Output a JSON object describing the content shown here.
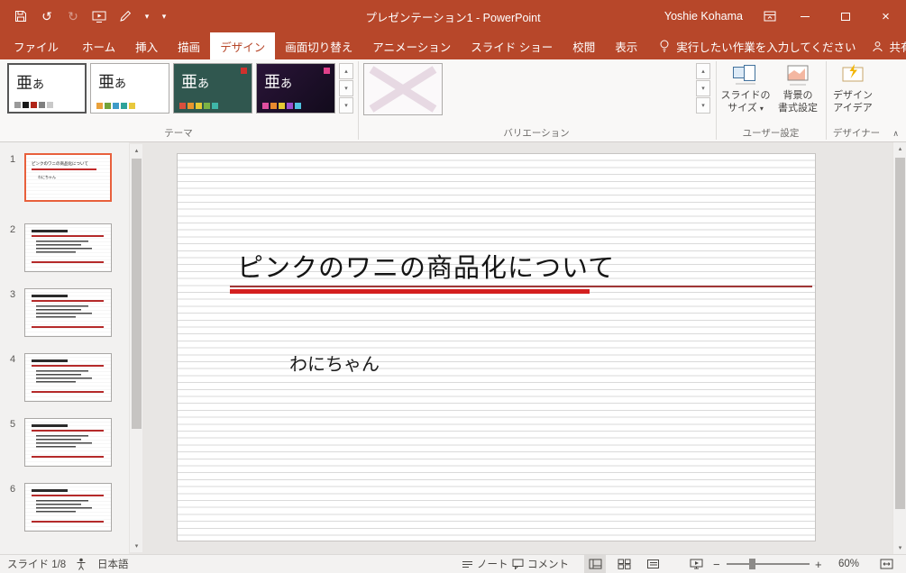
{
  "titlebar": {
    "title": "プレゼンテーション1 - PowerPoint",
    "user": "Yoshie Kohama"
  },
  "tabs": {
    "file": "ファイル",
    "home": "ホーム",
    "insert": "挿入",
    "draw": "描画",
    "design": "デザイン",
    "transitions": "画面切り替え",
    "animations": "アニメーション",
    "slideshow": "スライド ショー",
    "review": "校閲",
    "view": "表示",
    "tell_me": "実行したい作業を入力してください",
    "share": "共有"
  },
  "ribbon": {
    "themes": [
      {
        "big": "亜",
        "small": "あ"
      },
      {
        "big": "亜",
        "small": "あ"
      },
      {
        "big": "亜",
        "small": "あ"
      },
      {
        "big": "亜",
        "small": "あ"
      }
    ],
    "groups": {
      "themes": "テーマ",
      "variants": "バリエーション",
      "customize": "ユーザー設定",
      "designer": "デザイナー"
    },
    "slide_size": {
      "line1": "スライドの",
      "line2": "サイズ"
    },
    "format_background": {
      "line1": "背景の",
      "line2": "書式設定"
    },
    "design_ideas": {
      "line1": "デザイン",
      "line2": "アイデア"
    }
  },
  "slides_panel": {
    "slides": [
      {
        "number": "1"
      },
      {
        "number": "2"
      },
      {
        "number": "3"
      },
      {
        "number": "4"
      },
      {
        "number": "5"
      },
      {
        "number": "6"
      }
    ]
  },
  "slide": {
    "title": "ピンクのワニの商品化について",
    "subtitle": "わにちゃん"
  },
  "statusbar": {
    "slide_counter": "スライド 1/8",
    "language": "日本語",
    "notes": "ノート",
    "comments": "コメント",
    "zoom": "60%"
  },
  "icons": {
    "undo": "↺",
    "redo": "↻",
    "dropdown": "▾",
    "scroll_up": "▴",
    "scroll_down": "▾",
    "gallery_more": "▾",
    "collapse": "∧",
    "close": "×",
    "zoom_minus": "−",
    "zoom_plus": "+"
  },
  "colors": {
    "titlebar_red": "#B7472A",
    "selection_orange": "#E8603C",
    "slide_accent_red": "#D42020"
  }
}
